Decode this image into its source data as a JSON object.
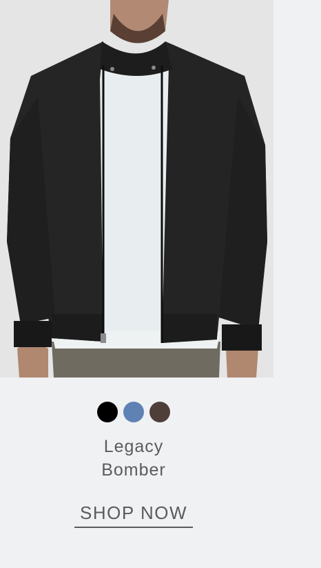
{
  "product": {
    "image_alt": "Man wearing black Legacy Bomber jacket over white tee",
    "name_line1": "Legacy",
    "name_line2": "Bomber",
    "cta_label": "SHOP NOW"
  },
  "colors": {
    "page_bg": "#f0f1f3",
    "photo_bg": "#e6e6e7",
    "text": "#5b5b5e"
  },
  "swatches": [
    {
      "name": "black-swatch",
      "color": "#000000"
    },
    {
      "name": "blue-swatch",
      "color": "#5f82b5"
    },
    {
      "name": "brown-swatch",
      "color": "#4e3f38"
    }
  ]
}
